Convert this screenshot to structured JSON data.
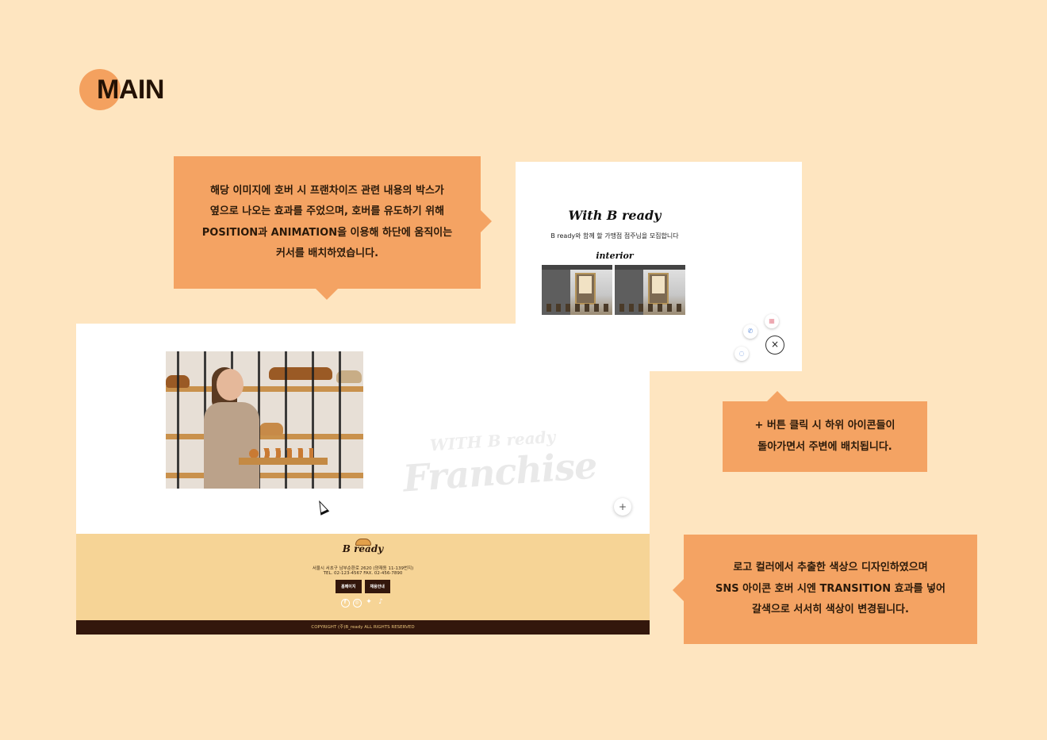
{
  "heading": {
    "title": "MAIN"
  },
  "callout_hover": {
    "lines": [
      "해당 이미지에 호버 시 프랜차이즈 관련 내용의 박스가",
      "옆으로 나오는 효과를 주었으며, 호버를 유도하기 위해",
      "POSITION과 ANIMATION을 이용해 하단에 움직이는",
      "커서를 배치하였습니다."
    ]
  },
  "callout_plus": {
    "lines": [
      "+ 버튼 클릭 시 하위 아이콘들이",
      "돌아가면서 주변에 배치됩니다."
    ]
  },
  "callout_footer": {
    "lines": [
      "로고 컬러에서 추출한 색상으 디자인하였으며",
      "SNS 아이콘 호버 시엔 TRANSITION 효과를 넣어",
      "갈색으로 서서히 색상이 변경됩니다."
    ]
  },
  "hover_panel": {
    "title": "With B ready",
    "description": "B ready와 함께 할 가맹점 점주님을 모집합니다",
    "subtitle": "interior",
    "close_symbol": "×",
    "fab_icons": [
      "phone-icon",
      "store-icon",
      "chat-icon"
    ]
  },
  "main_page": {
    "watermark_small": "WITH B ready",
    "watermark_big": "Franchise",
    "plus_symbol": "+"
  },
  "footer": {
    "logo_text": "B ready",
    "address": "서울시 서초구 남부순환로 2620 (양재동 11-139번지)",
    "tel": "TEL. 02-123-4567   FAX. 02-456-7890",
    "buttons": [
      "홈페이지",
      "채용안내"
    ],
    "sns": [
      "facebook-icon",
      "instagram-icon",
      "twitter-icon",
      "tiktok-icon"
    ],
    "copyright": "COPYRIGHT (주)B_ready ALL RIGHTS RESERVED"
  },
  "colors": {
    "background": "#fee5c0",
    "accent": "#f4a363",
    "footer_bg": "#f6d496",
    "brown": "#33170c"
  }
}
